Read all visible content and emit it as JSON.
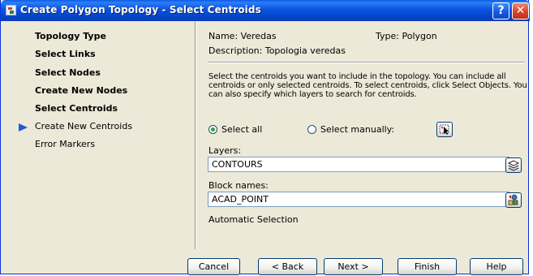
{
  "window": {
    "title": "Create Polygon Topology - Select Centroids",
    "help_label": "?",
    "close_label": "✕"
  },
  "nav": {
    "items": [
      {
        "label": "Topology Type",
        "bold": true
      },
      {
        "label": "Select Links",
        "bold": true
      },
      {
        "label": "Select Nodes",
        "bold": true
      },
      {
        "label": "Create New Nodes",
        "bold": true
      },
      {
        "label": "Select Centroids",
        "bold": true,
        "current": true
      },
      {
        "label": "Create New Centroids",
        "bold": false
      },
      {
        "label": "Error Markers",
        "bold": false
      }
    ],
    "current_marker_color": "#1e5bd6"
  },
  "info": {
    "name": "Name: Veredas",
    "type": "Type: Polygon",
    "description": "Description: Topologia veredas"
  },
  "instructions": "Select the centroids you want to include in the topology. You can include all centroids or only selected centroids. To select centroids, click Select Objects. You can also specify which layers to search for centroids.",
  "selection": {
    "select_all_label": "Select all",
    "select_manually_label": "Select manually:",
    "selected": "select_all",
    "select_objects_icon": "pick-objects-icon"
  },
  "layers": {
    "label": "Layers:",
    "value": "CONTOURS",
    "picker_icon": "layers-icon"
  },
  "block_names": {
    "label": "Block names:",
    "value": "ACAD_POINT",
    "picker_icon": "blocks-icon"
  },
  "auto_selection_label": "Automatic Selection",
  "buttons": {
    "cancel": "Cancel",
    "back": "< Back",
    "next": "Next >",
    "finish": "Finish",
    "help": "Help"
  },
  "colors": {
    "titlebar": "#0a53df",
    "dialog_bg": "#ece9d8",
    "radio_dot": "#2fa52f"
  }
}
